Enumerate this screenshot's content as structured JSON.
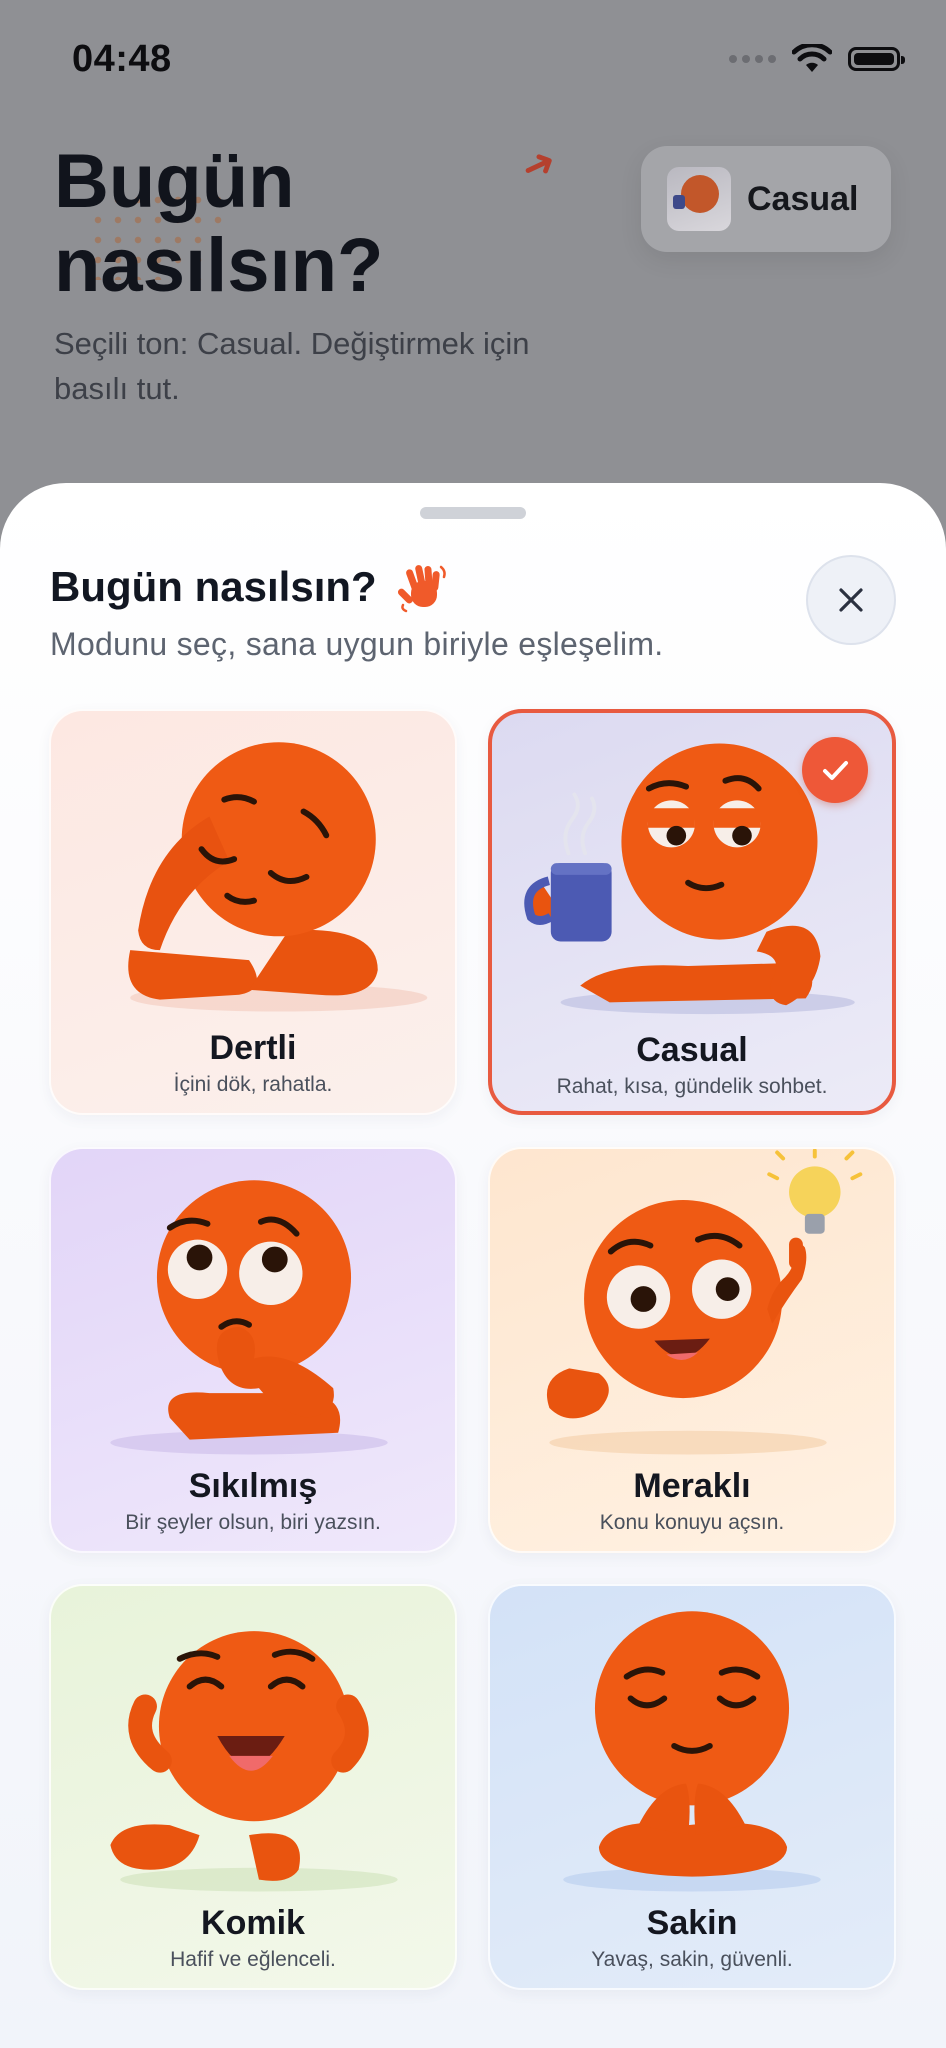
{
  "status_bar": {
    "time": "04:48"
  },
  "background": {
    "title": "Bugün nasılsın?",
    "subtitle": "Seçili ton: Casual. Değiştirmek için basılı tut.",
    "tone_chip": {
      "label": "Casual"
    }
  },
  "sheet": {
    "title": "Bugün nasılsın?",
    "subtitle": "Modunu seç, sana uygun biriyle eşleşelim.",
    "moods": [
      {
        "name": "Dertli",
        "desc": "İçini dök, rahatla.",
        "selected": false
      },
      {
        "name": "Casual",
        "desc": "Rahat, kısa, gündelik sohbet.",
        "selected": true
      },
      {
        "name": "Sıkılmış",
        "desc": "Bir şeyler olsun, biri yazsın.",
        "selected": false
      },
      {
        "name": "Meraklı",
        "desc": "Konu konuyu açsın.",
        "selected": false
      },
      {
        "name": "Komik",
        "desc": "Hafif ve eğlenceli.",
        "selected": false
      },
      {
        "name": "Sakin",
        "desc": "Yavaş, sakin, güvenli.",
        "selected": false
      }
    ]
  },
  "colors": {
    "accent": "#ee5838",
    "character": "#ef5a14",
    "backdrop": "#8f9094"
  }
}
